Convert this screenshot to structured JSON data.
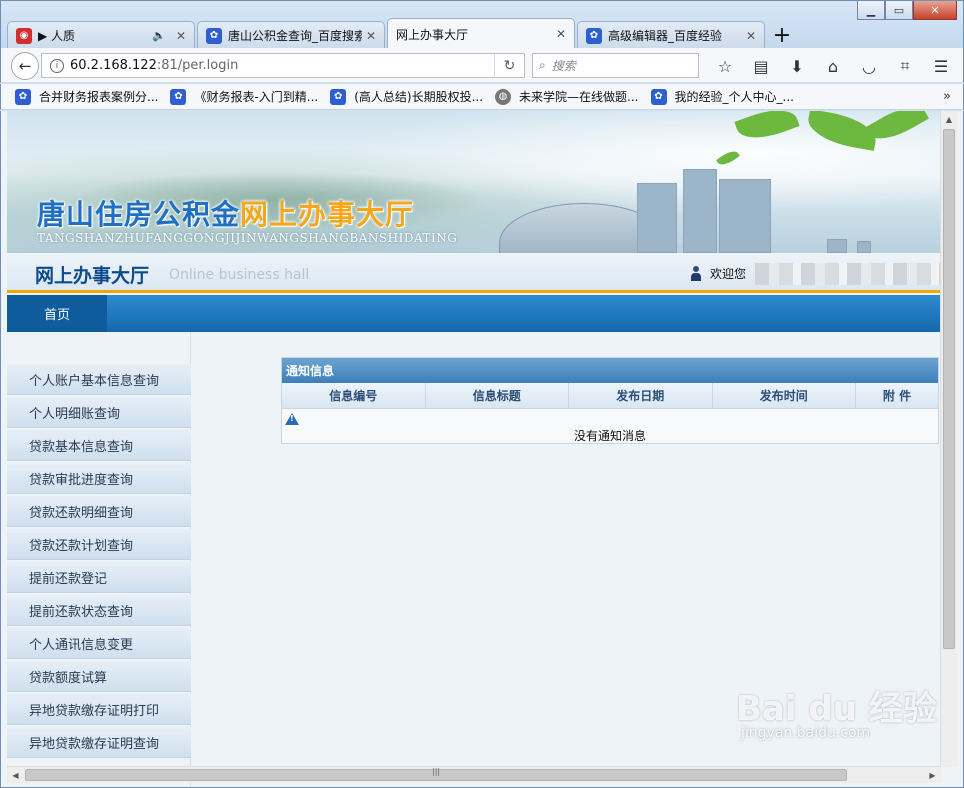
{
  "browser": {
    "tabs": [
      {
        "label": "▶ 人质",
        "active": false,
        "has_audio": true
      },
      {
        "label": "唐山公积金查询_百度搜索",
        "active": false
      },
      {
        "label": "网上办事大厅",
        "active": true
      },
      {
        "label": "高级编辑器_百度经验",
        "active": false
      }
    ],
    "new_tab_label": "+",
    "url_host": "60.2.168.122",
    "url_rest": ":81/per.login",
    "search_placeholder": "搜索",
    "bookmarks": [
      {
        "label": "合并财务报表案例分...",
        "icon": "paw-icon"
      },
      {
        "label": "《财务报表-入门到精...",
        "icon": "paw-icon"
      },
      {
        "label": "(高人总结)长期股权投...",
        "icon": "paw-icon"
      },
      {
        "label": "未来学院—在线做题...",
        "icon": "globe-icon"
      },
      {
        "label": "我的经验_个人中心_...",
        "icon": "paw-icon"
      }
    ],
    "bookmarks_overflow": "»"
  },
  "banner": {
    "title_main": "唐山住房公积金",
    "title_highlight": "网上办事大厅",
    "subtitle": "TANGSHANZHUFANGGONGJIJINWANGSHANGBANSHIDATING"
  },
  "header": {
    "hall_title": "网上办事大厅",
    "hall_en": "Online business hall",
    "welcome": "欢迎您"
  },
  "nav": {
    "home": "首页"
  },
  "sidebar": {
    "items": [
      {
        "label": "个人账户基本信息查询"
      },
      {
        "label": "个人明细账查询"
      },
      {
        "label": "贷款基本信息查询"
      },
      {
        "label": "贷款审批进度查询"
      },
      {
        "label": "贷款还款明细查询"
      },
      {
        "label": "贷款还款计划查询"
      },
      {
        "label": "提前还款登记"
      },
      {
        "label": "提前还款状态查询"
      },
      {
        "label": "个人通讯信息变更"
      },
      {
        "label": "贷款额度试算"
      },
      {
        "label": "异地贷款缴存证明打印"
      },
      {
        "label": "异地贷款缴存证明查询"
      }
    ]
  },
  "notice": {
    "title": "通知信息",
    "columns": [
      "信息编号",
      "信息标题",
      "发布日期",
      "发布时间",
      "附 件"
    ],
    "empty_message": "没有通知消息"
  },
  "watermark": {
    "brand": "Bai du 经验",
    "url": "jingyan.baidu.com"
  }
}
